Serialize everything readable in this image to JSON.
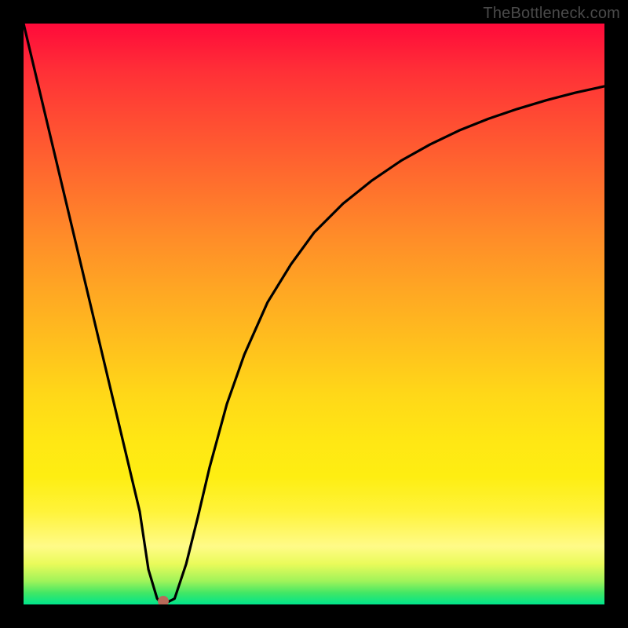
{
  "watermark": "TheBottleneck.com",
  "marker": {
    "x_pct": 24.0,
    "y_pct": 99.5
  },
  "chart_data": {
    "type": "line",
    "title": "",
    "xlabel": "",
    "ylabel": "",
    "xlim": [
      0,
      100
    ],
    "ylim": [
      0,
      100
    ],
    "grid": false,
    "legend": false,
    "annotations": [
      {
        "text": "TheBottleneck.com",
        "position": "top-right"
      }
    ],
    "marker": {
      "x": 24,
      "y": 0,
      "shape": "circle",
      "color": "#b96a5a"
    },
    "background_gradient": {
      "direction": "vertical",
      "stops": [
        {
          "pos": 0.0,
          "color": "#ff0a3a"
        },
        {
          "pos": 0.5,
          "color": "#ffb020"
        },
        {
          "pos": 0.85,
          "color": "#fff33a"
        },
        {
          "pos": 1.0,
          "color": "#00e58c"
        }
      ]
    },
    "series": [
      {
        "name": "curve",
        "color": "#000000",
        "x": [
          0,
          5,
          10,
          15,
          20,
          21.5,
          23,
          24,
          26,
          28,
          30,
          32,
          35,
          38,
          42,
          46,
          50,
          55,
          60,
          65,
          70,
          75,
          80,
          85,
          90,
          95,
          100
        ],
        "y": [
          100,
          79,
          58,
          37,
          16,
          6,
          1,
          0,
          1,
          7,
          15,
          23.5,
          34.5,
          43,
          52,
          58.5,
          64,
          69,
          73,
          76.4,
          79.2,
          81.6,
          83.6,
          85.3,
          86.8,
          88.1,
          89.2
        ]
      }
    ]
  }
}
